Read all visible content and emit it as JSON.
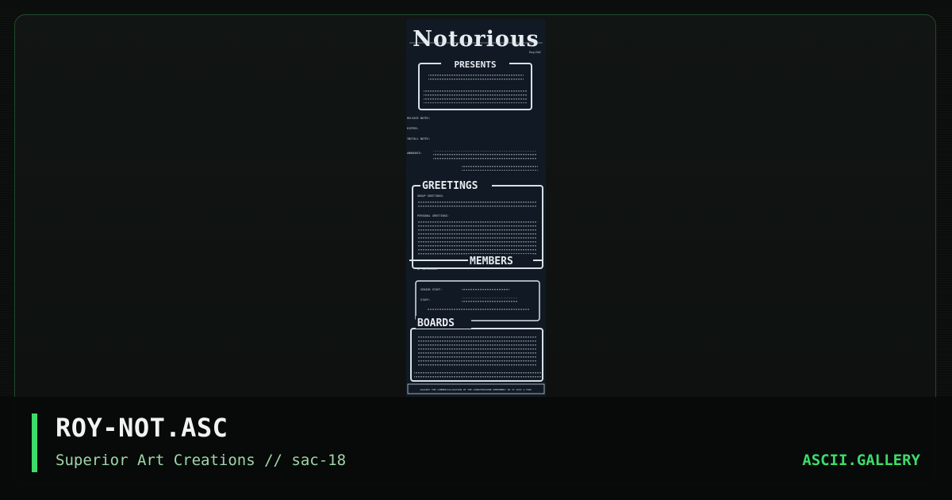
{
  "artwork": {
    "filename": "ROY-NOT.ASC",
    "group": "Superior Art Creations // sac-18",
    "site": "ASCII.GALLERY",
    "ascii_logo": "Notorious",
    "ascii_logo_tag": "Roy/SAC",
    "sections": {
      "presents": "PRESENTS",
      "greetings": "GREETINGS",
      "members": "MEMBERS",
      "boards": "BOARDS"
    },
    "labels": {
      "release_notes": "RELEASE NOTES:",
      "ripper": "RIPPER:",
      "install_notes": "INSTALL NOTES:",
      "announce": "ANNOUNCE:",
      "group_greetings": "GROUP GREETINGS:",
      "personal_greetings": "PERSONAL GREETINGS:",
      "of_notorious": "OF NOTORIOUS",
      "senior_staff": "SENIOR STAFF:",
      "staff": "STAFF:"
    },
    "footer_line": "AGAINST THE COMMERCIALIZATION OF THE COMPUTERSCENE REMEMBER? DO IT JUST 4 FUN!"
  },
  "colors": {
    "accent": "#3ddc6a",
    "title": "#f2f2f2",
    "subtitle": "#9fd6a8",
    "art_bg": "#111a24"
  }
}
